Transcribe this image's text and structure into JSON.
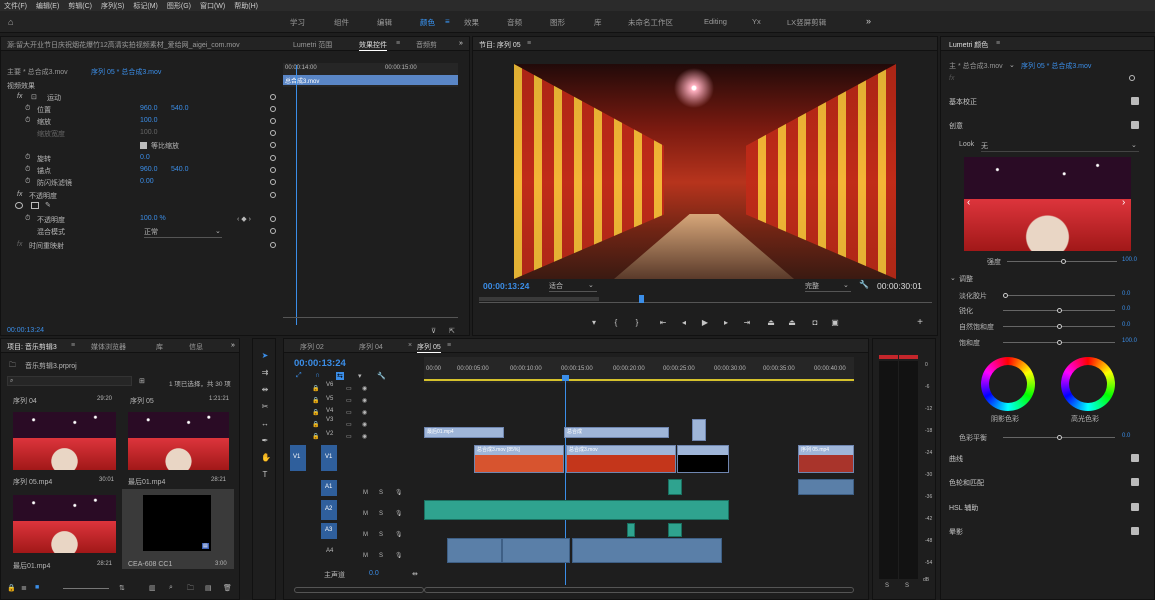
{
  "menu": [
    "文件(F)",
    "编辑(E)",
    "剪辑(C)",
    "序列(S)",
    "标记(M)",
    "图形(G)",
    "窗口(W)",
    "帮助(H)"
  ],
  "workspaces": [
    "学习",
    "组件",
    "编辑",
    "颜色",
    "效果",
    "音频",
    "图形",
    "库",
    "未命名工作区",
    "Editing",
    "Yx",
    "LX竖屏剪辑"
  ],
  "active_workspace": "颜色",
  "source_panel": {
    "tab_source": "源:留大开业节日庆祝烟花爆竹12高清实拍视频素材_爱给网_aigei_com.mov",
    "tab_lumetri_scope": "Lumetri 范围",
    "tab_effect_controls": "效果控件",
    "tab_audio": "音频剪",
    "master": "主要 * 总合成3.mov",
    "sequence": "序列 05 * 总合成3.mov",
    "timecode_start": "00:00:14:00",
    "timecode_mid": "00:00:15:00",
    "clip_label": "总合成3.mov",
    "video_effects": "视频效果",
    "motion": "运动",
    "position_label": "位置",
    "position_x": "960.0",
    "position_y": "540.0",
    "scale_label": "缩放",
    "scale_val": "100.0",
    "scale_width_label": "缩放宽度",
    "scale_width_val": "100.0",
    "uniform_scale": "等比缩放",
    "rotation_label": "旋转",
    "rotation_val": "0.0",
    "anchor_label": "锚点",
    "anchor_x": "960.0",
    "anchor_y": "540.0",
    "antiflicker_label": "防闪烁滤镜",
    "antiflicker_val": "0.00",
    "opacity_section": "不透明度",
    "opacity_label": "不透明度",
    "opacity_val": "100.0 %",
    "blend_label": "混合模式",
    "blend_val": "正常",
    "time_remap": "时间重映射",
    "bottom_timecode": "00:00:13:24"
  },
  "program": {
    "title": "节目: 序列 05",
    "timecode": "00:00:13:24",
    "fit": "适合",
    "quality": "完整",
    "duration": "00:00:30:01"
  },
  "project": {
    "tab_project": "项目: 音乐剪辑3",
    "tab_media_browser": "媒体浏览器",
    "tab_library": "库",
    "tab_info": "信息",
    "file": "音乐剪辑3.prproj",
    "selection": "1 项已选择，共 30 项",
    "items": [
      {
        "name": "序列 04",
        "dur": "29:20"
      },
      {
        "name": "序列 05",
        "dur": "1:21:21"
      },
      {
        "name": "序列 05.mp4",
        "dur": "30:01"
      },
      {
        "name": "最后01.mp4",
        "dur": "28:21"
      },
      {
        "name": "最后01.mp4",
        "dur": "28:21"
      },
      {
        "name": "CEA-608 CC1",
        "dur": "3:00"
      }
    ]
  },
  "timeline": {
    "tabs": [
      "序列 02",
      "序列 04",
      "序列 05"
    ],
    "active_tab": "序列 05",
    "timecode": "00:00:13:24",
    "ruler": [
      "00:00",
      "00:00:05:00",
      "00:00:10:00",
      "00:00:15:00",
      "00:00:20:00",
      "00:00:25:00",
      "00:00:30:00",
      "00:00:35:00",
      "00:00:40:00"
    ],
    "tracks_video": [
      "V6",
      "V5",
      "V4",
      "V3",
      "V2",
      "V1"
    ],
    "tracks_audio": [
      "A1",
      "A2",
      "A3",
      "A4"
    ],
    "source_v": "V1",
    "master": "主声道",
    "master_val": "0.0",
    "clips": {
      "v2_a": "最后01.mp4",
      "v2_b": "总合成",
      "v1_a": "总合成3.mov [85%]",
      "v1_b": "总合成3.mov",
      "v1_c": "序列 05.mp4"
    }
  },
  "meter": {
    "labels": [
      "0",
      "-6",
      "-12",
      "-18",
      "-24",
      "-30",
      "-36",
      "-42",
      "-48",
      "-54",
      "dB"
    ],
    "solo": [
      "S",
      "S"
    ]
  },
  "lumetri": {
    "title": "Lumetri 颜色",
    "master": "主 * 总合成3.mov",
    "sequence": "序列 05 * 总合成3.mov",
    "basic": "基本校正",
    "creative": "创意",
    "look_label": "Look",
    "look_val": "无",
    "intensity_label": "强度",
    "intensity_val": "100.0",
    "adjust": "调整",
    "faded_label": "淡化胶片",
    "faded_val": "0.0",
    "sharpen_label": "锐化",
    "sharpen_val": "0.0",
    "vibrance_label": "自然饱和度",
    "vibrance_val": "0.0",
    "saturation_label": "饱和度",
    "saturation_val": "100.0",
    "shadow_tint": "阴影色彩",
    "highlight_tint": "高光色彩",
    "tint_balance_label": "色彩平衡",
    "tint_balance_val": "0.0",
    "curves": "曲线",
    "wheels": "色轮和匹配",
    "hsl": "HSL 辅助",
    "vignette": "晕影"
  }
}
